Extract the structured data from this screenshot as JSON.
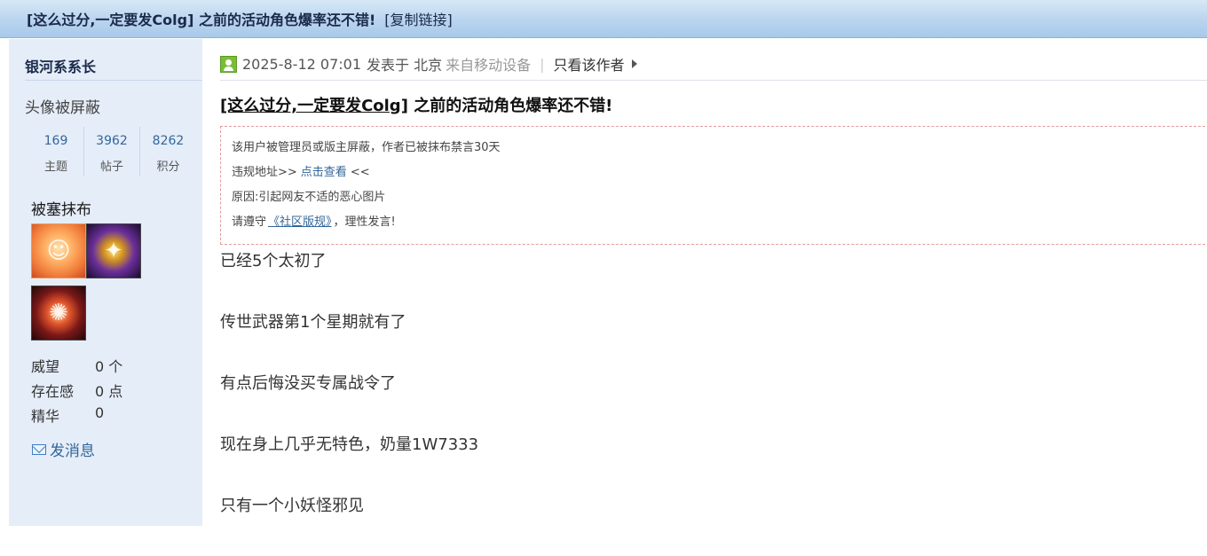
{
  "header": {
    "title": "[这么过分,一定要发Colg] 之前的活动角色爆率还不错!",
    "copy_link": "[复制链接]"
  },
  "sidebar": {
    "author_name": "银河系系长",
    "avatar_text": "头像被屏蔽",
    "stats": [
      {
        "value": "169",
        "label": "主题"
      },
      {
        "value": "3962",
        "label": "帖子"
      },
      {
        "value": "8262",
        "label": "积分"
      }
    ],
    "badge_title": "被塞抹布",
    "profile": [
      {
        "key": "威望",
        "value": "0 个"
      },
      {
        "key": "存在感",
        "value": "0 点"
      },
      {
        "key": "精华",
        "value": "0"
      }
    ],
    "send_message": "发消息"
  },
  "post": {
    "meta": {
      "datetime": "2025-8-12 07:01",
      "posted_at": "发表于 北京",
      "device": "来自移动设备",
      "separator": "|",
      "only_author": "只看该作者"
    },
    "title_link": "[这么过分,一定要发Colg]",
    "title_rest": " 之前的活动角色爆率还不错!",
    "notice": {
      "line1": "该用户被管理员或版主屏蔽，作者已被抹布禁言30天",
      "line2_prefix": "违规地址>>",
      "line2_link": "点击查看",
      "line2_suffix": "<<",
      "line3": "原因:引起网友不适的恶心图片",
      "line4_prefix": "请遵守",
      "line4_link": "《社区版规》",
      "line4_suffix": "，理性发言!"
    },
    "body": [
      "已经5个太初了",
      "传世武器第1个星期就有了",
      "有点后悔没买专属战令了",
      "现在身上几乎无特色，奶量1W7333",
      "只有一个小妖怪邪见"
    ]
  }
}
